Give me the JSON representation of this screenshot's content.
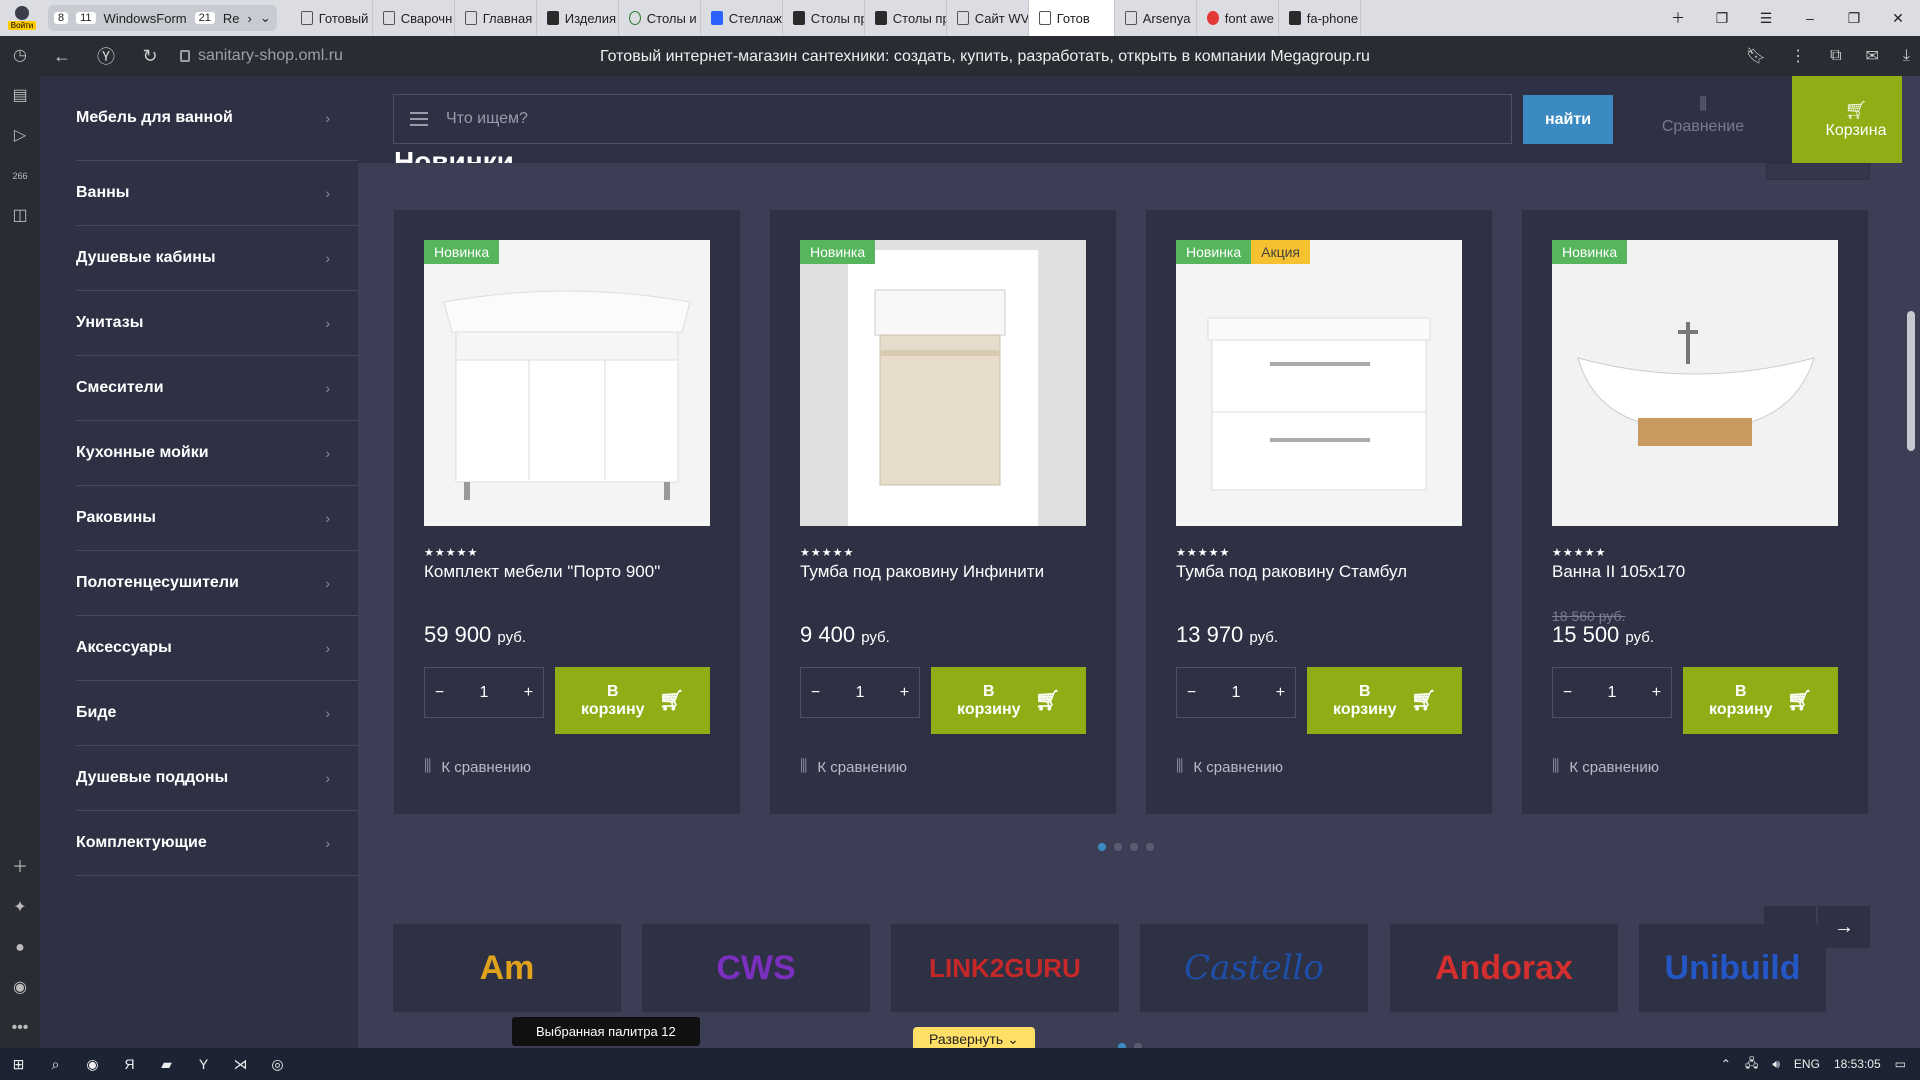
{
  "browser": {
    "profile_label": "Войти",
    "tab_group": {
      "count_a": "8",
      "count_b": "11",
      "name_a": "WindowsForm",
      "count_c": "21",
      "name_b": "Re"
    },
    "tabs": [
      {
        "label": "Готовый",
        "icon": "doc"
      },
      {
        "label": "Сварочн",
        "icon": "doc"
      },
      {
        "label": "Главная",
        "icon": "doc"
      },
      {
        "label": "Изделия",
        "icon": "image"
      },
      {
        "label": "Столы и",
        "icon": "green"
      },
      {
        "label": "Стеллаж",
        "icon": "blue"
      },
      {
        "label": "Столы пр",
        "icon": "dark"
      },
      {
        "label": "Столы пр",
        "icon": "image"
      },
      {
        "label": "Сайт WV",
        "icon": "doc"
      },
      {
        "label": "Готов",
        "icon": "doc",
        "active": true
      },
      {
        "label": "Arsenya",
        "icon": "doc"
      },
      {
        "label": "font awe",
        "icon": "red"
      },
      {
        "label": "fa-phone",
        "icon": "dark"
      }
    ],
    "url": "sanitary-shop.oml.ru",
    "page_title": "Готовый интернет-магазин сантехники: создать, купить, разработать, открыть в компании Megagroup.ru"
  },
  "sidebar": {
    "items": [
      {
        "label": "Мебель для ванной"
      },
      {
        "label": "Ванны"
      },
      {
        "label": "Душевые кабины"
      },
      {
        "label": "Унитазы"
      },
      {
        "label": "Смесители"
      },
      {
        "label": "Кухонные мойки"
      },
      {
        "label": "Раковины"
      },
      {
        "label": "Полотенцесушители"
      },
      {
        "label": "Аксессуары"
      },
      {
        "label": "Биде"
      },
      {
        "label": "Душевые поддоны"
      },
      {
        "label": "Комплектующие"
      }
    ]
  },
  "header": {
    "search_placeholder": "Что ищем?",
    "search_button": "найти",
    "compare_label": "Сравнение",
    "cart_label": "Корзина"
  },
  "section": {
    "title": "Новинки"
  },
  "products": [
    {
      "badges": [
        "Новинка"
      ],
      "name": "Комплект мебели \"Порто 900\"",
      "old_price": "",
      "price": "59 900",
      "currency": "руб.",
      "qty": "1",
      "cart_label": "В корзину",
      "compare_label": "К сравнению"
    },
    {
      "badges": [
        "Новинка"
      ],
      "name": "Тумба под раковину Инфинити",
      "old_price": "",
      "price": "9 400",
      "currency": "руб.",
      "qty": "1",
      "cart_label": "В корзину",
      "compare_label": "К сравнению"
    },
    {
      "badges": [
        "Новинка",
        "Акция"
      ],
      "name": "Тумба под раковину Стамбул",
      "old_price": "",
      "price": "13 970",
      "currency": "руб.",
      "qty": "1",
      "cart_label": "В корзину",
      "compare_label": "К сравнению"
    },
    {
      "badges": [
        "Новинка"
      ],
      "name": "Ванна II 105х170",
      "old_price": "18 560",
      "price": "15 500",
      "currency": "руб.",
      "qty": "1",
      "cart_label": "В корзину",
      "compare_label": "К сравнению"
    }
  ],
  "brands": [
    {
      "text": "Am",
      "color": "#e0a11b"
    },
    {
      "text": "CWS",
      "color": "#7b2fbe"
    },
    {
      "text": "LINK2GURU",
      "color": "#c62828"
    },
    {
      "text": "Castello",
      "color": "#1e4fa8"
    },
    {
      "text": "Andorax",
      "color": "#d32f2f"
    },
    {
      "text": "Unibuild",
      "color": "#2457c5"
    }
  ],
  "tooltip": {
    "text": "Выбранная палитра 12"
  },
  "expand_label": "Развернуть",
  "taskbar": {
    "lang": "ENG",
    "time": "18:53:05"
  },
  "colors": {
    "accent_green": "#8fad15",
    "accent_blue": "#3b8bc2",
    "badge_new": "#57b55d",
    "badge_sale": "#f5c131",
    "panel": "#2e3044",
    "bg": "#3b3e55"
  }
}
